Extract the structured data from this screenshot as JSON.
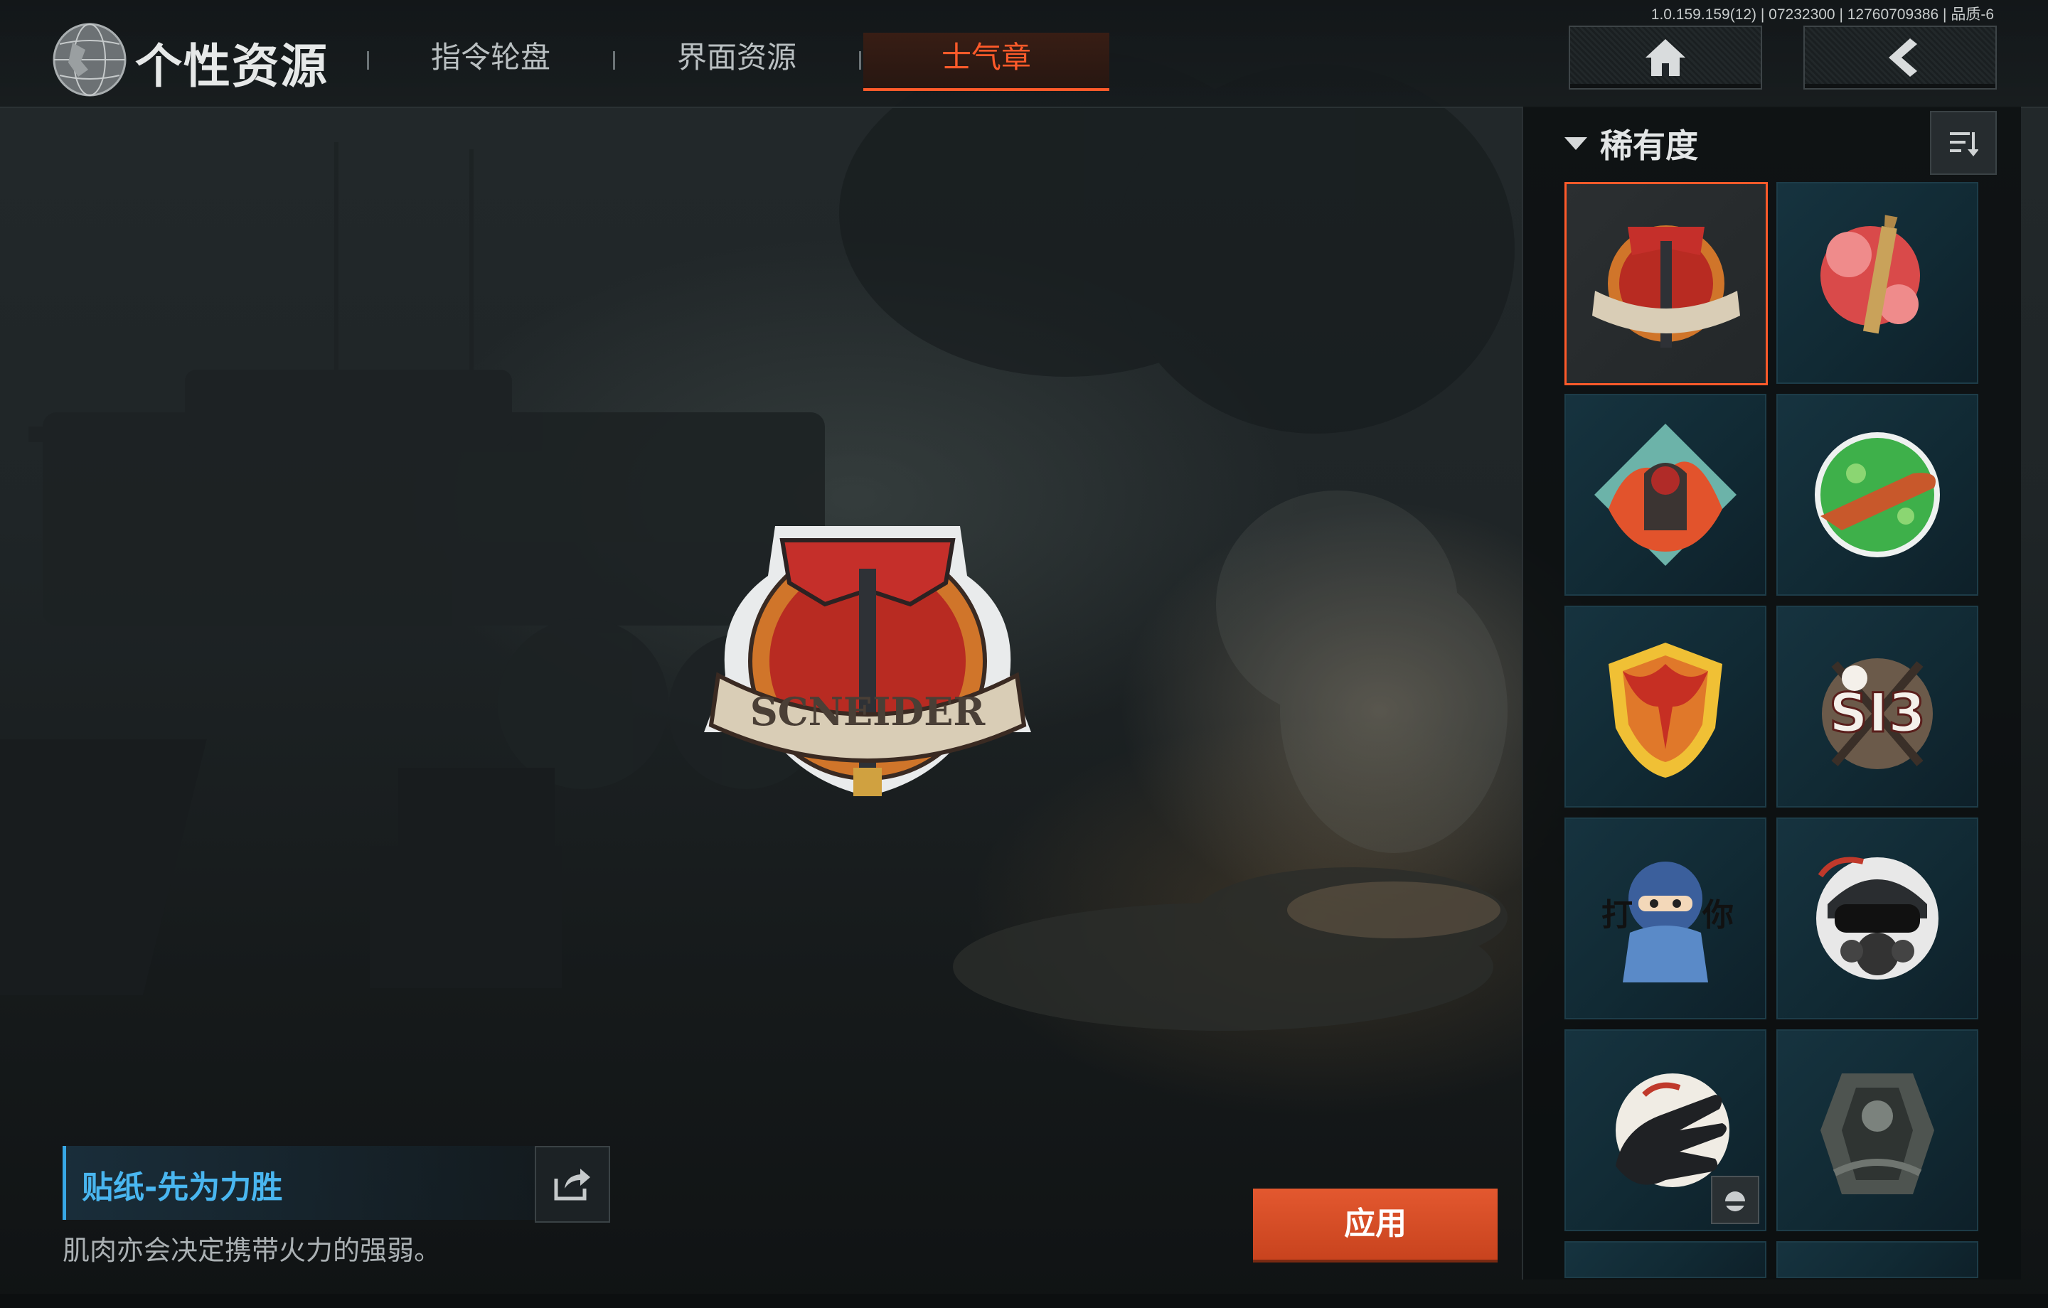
{
  "header": {
    "title": "个性资源",
    "tabs": [
      {
        "label": "指令轮盘",
        "active": false
      },
      {
        "label": "界面资源",
        "active": false
      },
      {
        "label": "士气章",
        "active": true
      }
    ],
    "version": "1.0.159.159(12) | 07232300 | 12760709386 | 品质-6",
    "home_icon": "home-icon",
    "back_icon": "back-arrow-icon"
  },
  "panel": {
    "filter_label": "稀有度",
    "sort_icon": "sort-icon",
    "stickers": [
      {
        "name": "scneider-crest",
        "selected": true,
        "locked": false
      },
      {
        "name": "flower-bullet",
        "selected": false,
        "locked": false
      },
      {
        "name": "fire-soldier-diamond",
        "selected": false,
        "locked": false
      },
      {
        "name": "green-bullet-circle",
        "selected": false,
        "locked": false
      },
      {
        "name": "phoenix-shield",
        "selected": false,
        "locked": false
      },
      {
        "name": "sig-emblem",
        "selected": false,
        "locked": false
      },
      {
        "name": "chibi-operator",
        "selected": false,
        "locked": false
      },
      {
        "name": "gas-mask-soldier",
        "selected": false,
        "locked": false
      },
      {
        "name": "glove-hand",
        "selected": false,
        "locked": true
      },
      {
        "name": "dark-armor",
        "selected": false,
        "locked": false
      }
    ]
  },
  "selected_item": {
    "name": "贴纸-先为力胜",
    "description": "肌肉亦会决定携带火力的强弱。",
    "apply_label": "应用"
  },
  "colors": {
    "accent": "#ff5a2a",
    "title_blue": "#49b6f0",
    "apply_bg": "#d94d25"
  }
}
